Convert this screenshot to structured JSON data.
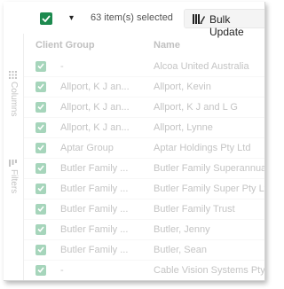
{
  "toolbar": {
    "selection_count": "63 item(s) selected",
    "caret": "▾",
    "bulk_update_label": "Bulk Update"
  },
  "side_panel": {
    "columns_label": "Columns",
    "filters_label": "Filters"
  },
  "columns": {
    "client_group": "Client Group",
    "name": "Name"
  },
  "rows": [
    {
      "group": "-",
      "name": "Alcoa United Australia"
    },
    {
      "group": "Allport, K J an...",
      "name": "Allport, Kevin"
    },
    {
      "group": "Allport, K J an...",
      "name": "Allport, K J and L G"
    },
    {
      "group": "Allport, K J an...",
      "name": "Allport, Lynne"
    },
    {
      "group": "Aptar Group",
      "name": "Aptar Holdings Pty Ltd"
    },
    {
      "group": "Butler Family ...",
      "name": "Butler Family Superannuatio"
    },
    {
      "group": "Butler Family ...",
      "name": "Butler Family Super Pty Ltd"
    },
    {
      "group": "Butler Family ...",
      "name": "Butler Family Trust"
    },
    {
      "group": "Butler Family ...",
      "name": "Butler, Jenny"
    },
    {
      "group": "Butler Family ...",
      "name": "Butler, Sean"
    },
    {
      "group": "-",
      "name": "Cable Vision Systems Pty Ltd"
    }
  ],
  "colors": {
    "checkbox_active": "#1d8a4f",
    "checkbox_faded": "#a6d5bb",
    "faded_text": "#c4c4c4"
  }
}
